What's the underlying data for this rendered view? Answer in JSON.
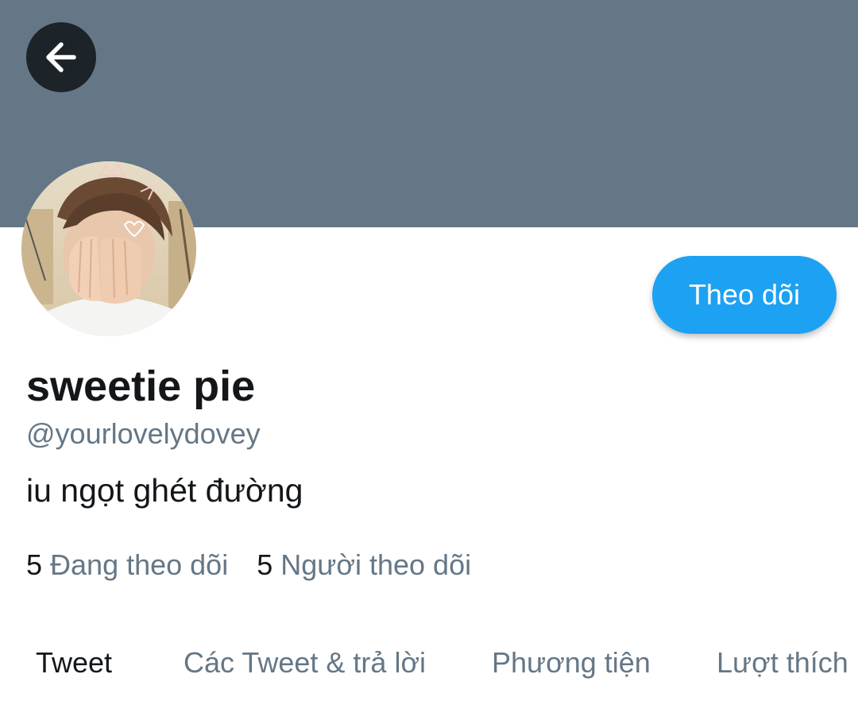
{
  "header": {
    "back_icon": "arrow-left-icon",
    "banner_color": "#657786"
  },
  "profile": {
    "display_name": "sweetie pie",
    "handle": "@yourlovelydovey",
    "bio": "iu ngọt ghét đường",
    "follow_label": "Theo dõi",
    "accent_color": "#1da1f2"
  },
  "stats": {
    "following_count": "5",
    "following_label": "Đang theo dõi",
    "followers_count": "5",
    "followers_label": "Người theo dõi"
  },
  "tabs": [
    {
      "label": "Tweet",
      "active": true
    },
    {
      "label": "Các Tweet & trả lời",
      "active": false
    },
    {
      "label": "Phương tiện",
      "active": false
    },
    {
      "label": "Lượt thích",
      "active": false
    }
  ]
}
